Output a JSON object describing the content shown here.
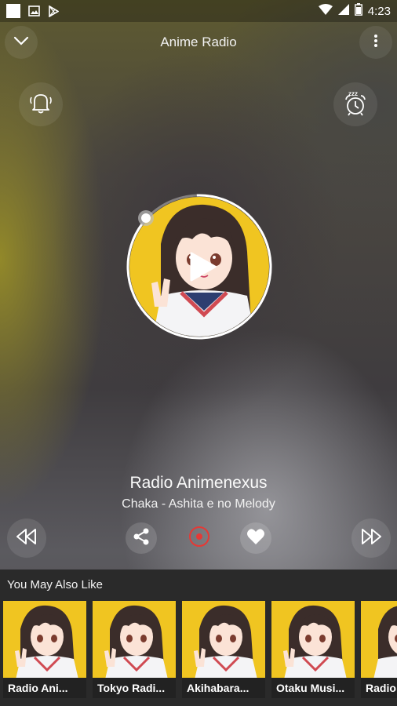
{
  "status_bar": {
    "time": "4:23",
    "icons": [
      "notification-square-icon",
      "image-icon",
      "play-store-icon",
      "wifi-icon",
      "signal-icon",
      "battery-icon"
    ]
  },
  "header": {
    "title": "Anime Radio",
    "left_icon": "chevron-down-icon",
    "right_icon": "more-vertical-icon"
  },
  "side_buttons": {
    "left_icon": "bell-ring-icon",
    "right_icon": "alarm-clock-sleep-icon"
  },
  "player": {
    "station_name": "Radio Animenexus",
    "track": "Chaka - Ashita e no Melody",
    "state_icon": "play-icon"
  },
  "controls": {
    "previous_icon": "rewind-icon",
    "share_icon": "share-icon",
    "record_icon": "record-icon",
    "favorite_icon": "heart-icon",
    "next_icon": "fast-forward-icon"
  },
  "recommendations": {
    "heading": "You May Also Like",
    "items": [
      {
        "label": "Radio Ani..."
      },
      {
        "label": "Tokyo Radi..."
      },
      {
        "label": "Akihabara..."
      },
      {
        "label": "Otaku Musi..."
      },
      {
        "label": "Radio"
      }
    ]
  },
  "colors": {
    "accent_record": "#e53935",
    "card_background": "#f0c521",
    "bottom_panel": "#2a2a2a"
  }
}
